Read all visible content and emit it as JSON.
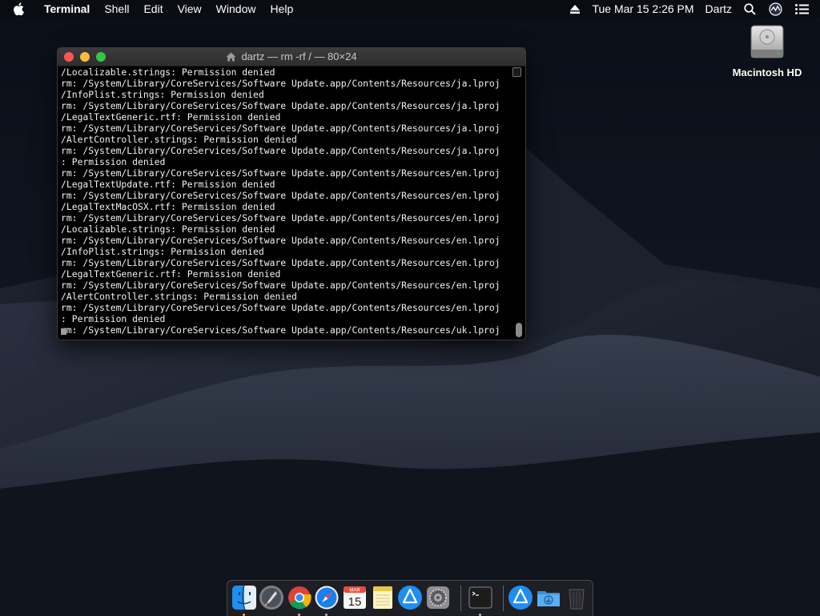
{
  "menubar": {
    "app_name": "Terminal",
    "menus": [
      "Shell",
      "Edit",
      "View",
      "Window",
      "Help"
    ],
    "clock": "Tue Mar 15  2:26 PM",
    "user": "Dartz"
  },
  "desktop": {
    "drive_label": "Macintosh HD"
  },
  "terminal": {
    "title": "dartz — rm -rf / — 80×24",
    "lines": [
      "/Localizable.strings: Permission denied",
      "rm: /System/Library/CoreServices/Software Update.app/Contents/Resources/ja.lproj",
      "/InfoPlist.strings: Permission denied",
      "rm: /System/Library/CoreServices/Software Update.app/Contents/Resources/ja.lproj",
      "/LegalTextGeneric.rtf: Permission denied",
      "rm: /System/Library/CoreServices/Software Update.app/Contents/Resources/ja.lproj",
      "/AlertController.strings: Permission denied",
      "rm: /System/Library/CoreServices/Software Update.app/Contents/Resources/ja.lproj",
      ": Permission denied",
      "rm: /System/Library/CoreServices/Software Update.app/Contents/Resources/en.lproj",
      "/LegalTextUpdate.rtf: Permission denied",
      "rm: /System/Library/CoreServices/Software Update.app/Contents/Resources/en.lproj",
      "/LegalTextMacOSX.rtf: Permission denied",
      "rm: /System/Library/CoreServices/Software Update.app/Contents/Resources/en.lproj",
      "/Localizable.strings: Permission denied",
      "rm: /System/Library/CoreServices/Software Update.app/Contents/Resources/en.lproj",
      "/InfoPlist.strings: Permission denied",
      "rm: /System/Library/CoreServices/Software Update.app/Contents/Resources/en.lproj",
      "/LegalTextGeneric.rtf: Permission denied",
      "rm: /System/Library/CoreServices/Software Update.app/Contents/Resources/en.lproj",
      "/AlertController.strings: Permission denied",
      "rm: /System/Library/CoreServices/Software Update.app/Contents/Resources/en.lproj",
      ": Permission denied",
      "rm: /System/Library/CoreServices/Software Update.app/Contents/Resources/uk.lproj"
    ]
  },
  "dock": {
    "apps": [
      {
        "icon": "finder-icon",
        "running": true
      },
      {
        "icon": "launchpad-icon",
        "running": false
      },
      {
        "icon": "chrome-icon",
        "running": true
      },
      {
        "icon": "safari-icon",
        "running": true
      },
      {
        "icon": "calendar-icon",
        "running": false
      },
      {
        "icon": "notes-icon",
        "running": false
      },
      {
        "icon": "app-store-icon",
        "running": false
      },
      {
        "icon": "system-preferences-icon",
        "running": false
      },
      {
        "icon": "terminal-icon",
        "running": true
      },
      {
        "icon": "app-store-folder-icon",
        "running": false
      },
      {
        "icon": "downloads-folder-icon",
        "running": false
      },
      {
        "icon": "trash-icon",
        "running": false
      }
    ],
    "calendar": {
      "month": "MAR",
      "day": "15"
    }
  },
  "colors": {
    "close": "#fc5753",
    "minimize": "#fdbc40",
    "zoom": "#33c748"
  }
}
